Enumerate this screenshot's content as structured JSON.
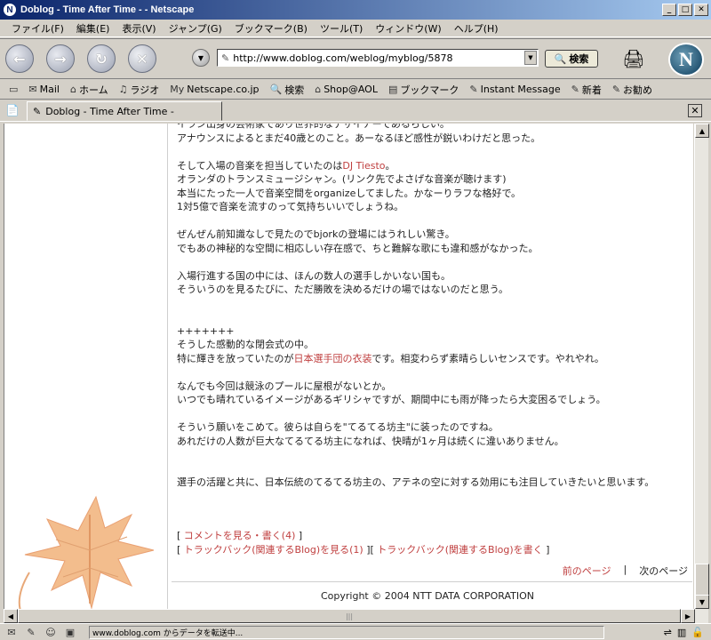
{
  "window": {
    "title": "Doblog - Time After Time - - Netscape",
    "app_icon_glyph": "N"
  },
  "menu": [
    "ファイル(F)",
    "編集(E)",
    "表示(V)",
    "ジャンプ(G)",
    "ブックマーク(B)",
    "ツール(T)",
    "ウィンドウ(W)",
    "ヘルプ(H)"
  ],
  "nav": {
    "url": "http://www.doblog.com/weblog/myblog/5878",
    "search_label": "検索"
  },
  "personal_toolbar": [
    "Mail",
    "ホーム",
    "ラジオ",
    "Netscape.co.jp",
    "検索",
    "Shop@AOL",
    "ブックマーク",
    "Instant Message",
    "新着",
    "お勧め"
  ],
  "tab": {
    "title": "Doblog - Time After Time -"
  },
  "article": {
    "lines": [
      "イラン出身の芸術家であり世界的なデザイナーであるらしい。",
      "アナウンスによるとまだ40歳とのこと。あーなるほど感性が鋭いわけだと思った。",
      "",
      {
        "pre": "そして入場の音楽を担当していたのは",
        "link": "DJ Tiesto",
        "post": "。"
      },
      "オランダのトランスミュージシャン。(リンク先でよさげな音楽が聴けます)",
      "本当にたった一人で音楽空間をorganizeしてました。かなーりラフな格好で。",
      "1対5億で音楽を流すのって気持ちいいでしょうね。",
      "",
      "ぜんぜん前知識なしで見たのでbjorkの登場にはうれしい驚き。",
      "でもあの神秘的な空間に相応しい存在感で、ちと難解な歌にも違和感がなかった。",
      "",
      "入場行進する国の中には、ほんの数人の選手しかいない国も。",
      "そういうのを見るたびに、ただ勝敗を決めるだけの場ではないのだと思う。",
      "",
      "",
      "+++++++",
      "そうした感動的な閉会式の中。",
      {
        "pre": "特に輝きを放っていたのが",
        "link": "日本選手団の衣装",
        "post": "です。相変わらず素晴らしいセンスです。やれやれ。"
      },
      "",
      "なんでも今回は競泳のプールに屋根がないとか。",
      "いつでも晴れているイメージがあるギリシャですが、期間中にも雨が降ったら大変困るでしょう。",
      "",
      "そういう願いをこめて。彼らは自らを\"てるてる坊主\"に装ったのですね。",
      "あれだけの人数が巨大なてるてる坊主になれば、快晴が1ヶ月は続くに違いありません。",
      "",
      "",
      "選手の活躍と共に、日本伝統のてるてる坊主の、アテネの空に対する効用にも注目していきたいと思います。"
    ]
  },
  "footer": {
    "comment_link": "コメントを見る・書く(4)",
    "trackback_view": "トラックバック(関連するBlog)を見る(1)",
    "trackback_write": "トラックバック(関連するBlog)を書く",
    "prev": "前のページ",
    "sep": "|",
    "next": "次のページ",
    "copyright": "Copyright © 2004 NTT DATA CORPORATION"
  },
  "status": {
    "text": "www.doblog.com からデータを転送中..."
  }
}
